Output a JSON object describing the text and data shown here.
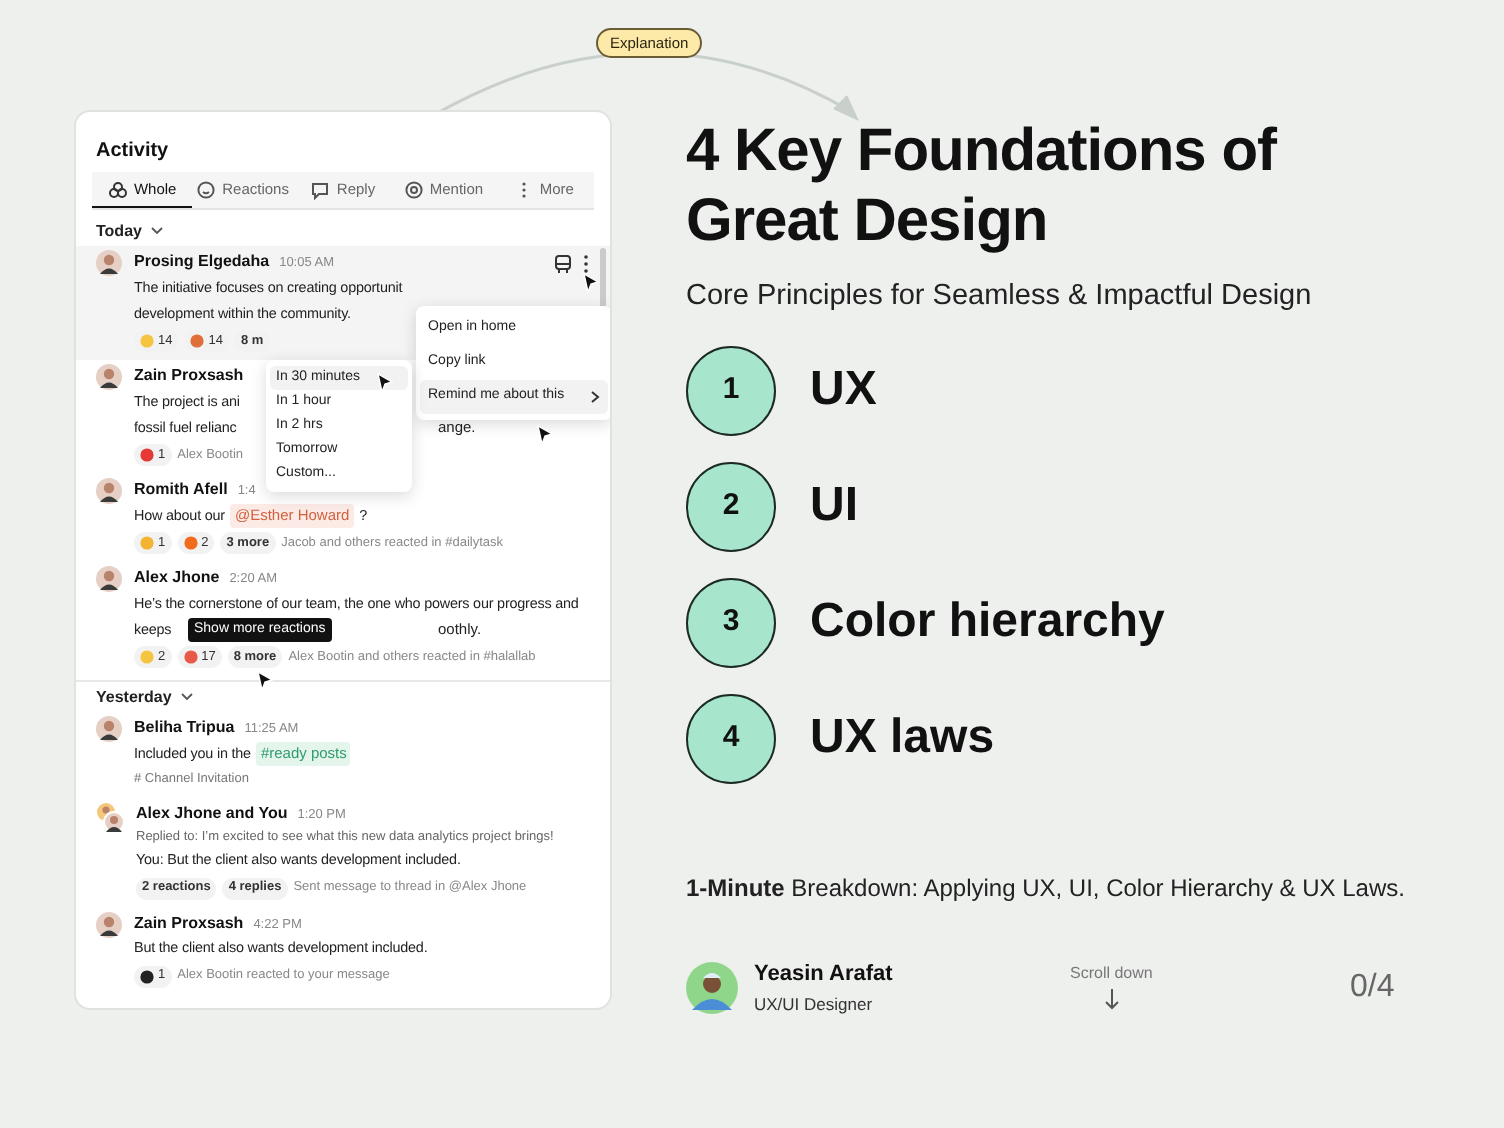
{
  "explanation_tag": "Explanation",
  "activity": {
    "title": "Activity",
    "tabs": [
      {
        "label": "Whole",
        "selected": true
      },
      {
        "label": "Reactions",
        "selected": false
      },
      {
        "label": "Reply",
        "selected": false
      },
      {
        "label": "Mention",
        "selected": false
      },
      {
        "label": "More",
        "selected": false
      }
    ],
    "sections": [
      {
        "label": "Today",
        "messages": [
          {
            "name": "Prosing Elgedaha",
            "time": "10:05 AM",
            "kind": "single",
            "highlighted": true,
            "lines": [
              [
                {
                  "kind": "plain",
                  "text": "The initiative focuses on creating opportunit"
                }
              ],
              [
                {
                  "kind": "plain",
                  "text": "development within the community."
                }
              ]
            ],
            "reactions": [
              {
                "kind": "emoji",
                "color": "#f5c542",
                "count": "14"
              },
              {
                "kind": "emoji",
                "color": "#e0703a",
                "count": "14"
              },
              {
                "kind": "more",
                "text": "8 m"
              }
            ]
          },
          {
            "name": "Zain Proxsash",
            "kind": "single",
            "highlighted": false,
            "lines": [
              [
                {
                  "kind": "plain",
                  "text": "The project is ani"
                }
              ],
              [
                {
                  "kind": "plain",
                  "text": "fossil fuel relianc"
                },
                {
                  "kind": "resume",
                  "text": "ange."
                }
              ]
            ],
            "reactions": [
              {
                "kind": "emoji",
                "color": "#e53935",
                "count": "1"
              },
              {
                "kind": "note",
                "text": "Alex Bootin"
              }
            ]
          },
          {
            "name": "Romith Afell",
            "time": "1:4",
            "kind": "single",
            "highlighted": false,
            "lines": [
              [
                {
                  "kind": "plain",
                  "text": "How about our"
                },
                {
                  "kind": "mention",
                  "text": "@Esther Howard"
                },
                {
                  "kind": "plain",
                  "text": "?"
                }
              ]
            ],
            "reactions": [
              {
                "kind": "emoji",
                "color": "#f2b431",
                "count": "1"
              },
              {
                "kind": "emoji",
                "color": "#f26b1d",
                "count": "2"
              },
              {
                "kind": "more",
                "text": "3 more"
              },
              {
                "kind": "note",
                "text": "Jacob and others reacted in #dailytask"
              }
            ]
          },
          {
            "name": "Alex Jhone",
            "time": "2:20 AM",
            "kind": "single",
            "highlighted": false,
            "lines": [
              [
                {
                  "kind": "plain",
                  "text": "He’s the cornerstone of our team, the one who powers our progress and"
                }
              ],
              [
                {
                  "kind": "plain",
                  "text": "keeps"
                },
                {
                  "kind": "resume",
                  "text": "oothly."
                }
              ]
            ],
            "reactions": [
              {
                "kind": "emoji",
                "color": "#f5c542",
                "count": "2"
              },
              {
                "kind": "emoji",
                "color": "#e8594a",
                "count": "17"
              },
              {
                "kind": "more",
                "text": "8 more"
              },
              {
                "kind": "note",
                "text": "Alex Bootin and others reacted in #halallab"
              }
            ]
          }
        ]
      },
      {
        "label": "Yesterday",
        "messages": [
          {
            "name": "Beliha Tripua",
            "time": "11:25 AM",
            "kind": "single",
            "highlighted": false,
            "lines": [
              [
                {
                  "kind": "plain",
                  "text": "Included you in the"
                },
                {
                  "kind": "channel",
                  "text": "#ready posts"
                }
              ]
            ],
            "footer": "# Channel Invitation"
          },
          {
            "name": "Alex Jhone and You",
            "time": "1:20 PM",
            "kind": "pair",
            "highlighted": false,
            "reply_to": "Replied to:  I’m excited to see what this new data analytics project brings!",
            "lines": [
              [
                {
                  "kind": "plain",
                  "text": "You:  But the client also wants development included."
                }
              ]
            ],
            "reactions": [
              {
                "kind": "more",
                "text": "2 reactions"
              },
              {
                "kind": "more",
                "text": "4 replies"
              },
              {
                "kind": "note",
                "text": "Sent message to thread in @Alex Jhone"
              }
            ]
          },
          {
            "name": "Zain Proxsash",
            "time": "4:22 PM",
            "kind": "single",
            "highlighted": false,
            "lines": [
              [
                {
                  "kind": "plain",
                  "text": "But the client also wants development included."
                }
              ]
            ],
            "reactions": [
              {
                "kind": "emoji",
                "color": "#222222",
                "count": "1"
              },
              {
                "kind": "note",
                "text": "Alex Bootin reacted to your message"
              }
            ]
          }
        ]
      }
    ],
    "menu": [
      {
        "label": "Open in home",
        "selected": false,
        "submenu": false
      },
      {
        "label": "Copy link",
        "selected": false,
        "submenu": false
      },
      {
        "label": "Remind me about this",
        "selected": true,
        "submenu": true
      }
    ],
    "submenu": [
      {
        "label": "In 30 minutes",
        "selected": true
      },
      {
        "label": "In 1 hour",
        "selected": false
      },
      {
        "label": "In 2 hrs",
        "selected": false
      },
      {
        "label": "Tomorrow",
        "selected": false
      },
      {
        "label": "Custom...",
        "selected": false
      }
    ],
    "tooltip": "Show more reactions"
  },
  "heading": [
    "4 Key Foundations of",
    "Great Design"
  ],
  "subheading": "Core Principles for Seamless & Impactful Design",
  "foundations": [
    {
      "number": "1",
      "label": "UX"
    },
    {
      "number": "2",
      "label": "UI"
    },
    {
      "number": "3",
      "label": "Color hierarchy"
    },
    {
      "number": "4",
      "label": "UX laws"
    }
  ],
  "breakdown": "**1-Minute** Breakdown: Applying UX, UI, Color Hierarchy & UX Laws.",
  "author": {
    "name": "Yeasin Arafat",
    "role": "UX/UI Designer"
  },
  "scroll_hint": "Scroll down",
  "progress": "0/4"
}
